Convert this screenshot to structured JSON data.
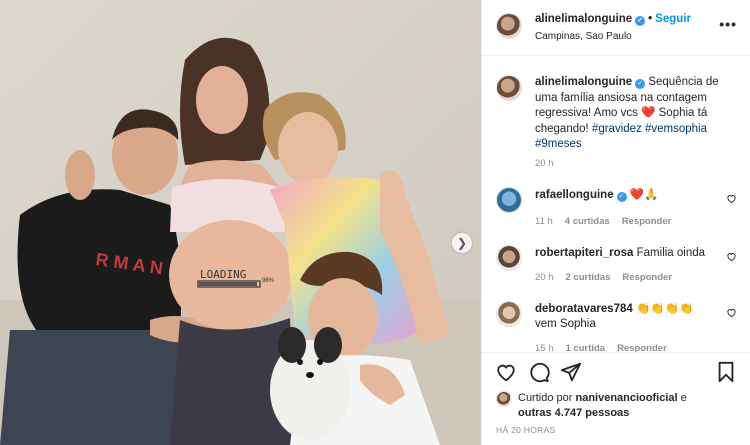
{
  "header": {
    "username": "alinelimalonguine",
    "follow_label": "Seguir",
    "separator": "•",
    "location": "Campinas, Sao Paulo",
    "more_label": "•••"
  },
  "photo": {
    "belly_text": "LOADING",
    "belly_small": "98%",
    "next_icon": "chevron-right-icon"
  },
  "caption": {
    "username": "alinelimalonguine",
    "text_before": "Sequência de uma família ansiosa na contagem regressiva! Amo vcs",
    "heart": "❤️",
    "text_after": "Sophia tá chegando!",
    "hashtags": [
      "#gravidez",
      "#vemsophia",
      "#9meses"
    ],
    "time": "20 h"
  },
  "comments": [
    {
      "username": "rafaellonguine",
      "text": "❤️🙏",
      "time": "11 h",
      "likes": "4 curtidas",
      "reply": "Responder"
    },
    {
      "username": "robertapiteri_rosa",
      "text": "Familia oinda",
      "time": "20 h",
      "likes": "2 curtidas",
      "reply": "Responder"
    },
    {
      "username": "deboratavares784",
      "text": "👏👏👏👏",
      "text2": "vem Sophia",
      "time": "15 h",
      "likes": "1 curtida",
      "reply": "Responder"
    }
  ],
  "actions": {
    "liked_prefix": "Curtido por",
    "liked_user": "nanivenanciooficial",
    "liked_and": "e",
    "liked_others": "outras 4.747 pessoas",
    "when": "HÁ 20 HORAS"
  },
  "colors": {
    "accent": "#0095f6",
    "verified": "#3897f0",
    "muted": "#8e8e8e",
    "heart": "#d2232a"
  }
}
